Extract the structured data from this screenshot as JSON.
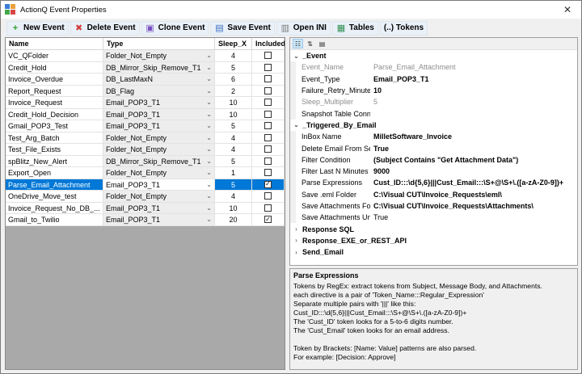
{
  "window": {
    "title": "ActionQ Event Properties",
    "close_glyph": "✕"
  },
  "toolbar": [
    {
      "label": "New Event",
      "icon": "plus-icon",
      "glyph": "+",
      "color": "#2e9e2e"
    },
    {
      "label": "Delete Event",
      "icon": "delete-document-icon",
      "glyph": "✖",
      "color": "#d23c3c"
    },
    {
      "label": "Clone Event",
      "icon": "clone-icon",
      "glyph": "▣",
      "color": "#7a4fbf"
    },
    {
      "label": "Save Event",
      "icon": "save-icon",
      "glyph": "▤",
      "color": "#3a6fc4"
    },
    {
      "label": "Open INI",
      "icon": "ini-file-icon",
      "glyph": "▥",
      "color": "#7a7a7a"
    },
    {
      "label": "Tables",
      "icon": "table-icon",
      "glyph": "▦",
      "color": "#2f8f4e"
    },
    {
      "label": "(..) Tokens",
      "icon": "",
      "glyph": "",
      "color": "#000000"
    }
  ],
  "grid": {
    "columns": [
      "Name",
      "Type",
      "Sleep_X",
      "Included"
    ],
    "rows": [
      {
        "name": "VC_QFolder",
        "type": "Folder_Not_Empty",
        "sleep": "4",
        "included": false
      },
      {
        "name": "Credit_Hold",
        "type": "DB_Mirror_Skip_Remove_T1",
        "sleep": "5",
        "included": false
      },
      {
        "name": "Invoice_Overdue",
        "type": "DB_LastMaxN",
        "sleep": "6",
        "included": false
      },
      {
        "name": "Report_Request",
        "type": "DB_Flag",
        "sleep": "2",
        "included": false
      },
      {
        "name": "Invoice_Request",
        "type": "Email_POP3_T1",
        "sleep": "10",
        "included": false
      },
      {
        "name": "Credit_Hold_Decision",
        "type": "Email_POP3_T1",
        "sleep": "10",
        "included": false
      },
      {
        "name": "Gmail_POP3_Test",
        "type": "Email_POP3_T1",
        "sleep": "5",
        "included": false
      },
      {
        "name": "Test_Arg_Batch",
        "type": "Folder_Not_Empty",
        "sleep": "4",
        "included": false
      },
      {
        "name": "Test_File_Exists",
        "type": "Folder_Not_Empty",
        "sleep": "4",
        "included": false
      },
      {
        "name": "spBlitz_New_Alert",
        "type": "DB_Mirror_Skip_Remove_T1",
        "sleep": "5",
        "included": false
      },
      {
        "name": "Export_Open",
        "type": "Folder_Not_Empty",
        "sleep": "1",
        "included": false
      },
      {
        "name": "Parse_Email_Attachment",
        "type": "Email_POP3_T1",
        "sleep": "5",
        "included": true,
        "selected": true
      },
      {
        "name": "OneDrive_Move_test",
        "type": "Folder_Not_Empty",
        "sleep": "4",
        "included": false
      },
      {
        "name": "Invoice_Request_No_DB_...",
        "type": "Email_POP3_T1",
        "sleep": "10",
        "included": false
      },
      {
        "name": "Gmail_to_Twilio",
        "type": "Email_POP3_T1",
        "sleep": "20",
        "included": true
      }
    ]
  },
  "props": {
    "categories": [
      {
        "label": "_Event",
        "expanded": true,
        "rows": [
          {
            "name": "Event_Name",
            "value": "Parse_Email_Attachment",
            "disabled": true
          },
          {
            "name": "Event_Type",
            "value": "Email_POP3_T1"
          },
          {
            "name": "Failure_Retry_Minutes",
            "value": "10"
          },
          {
            "name": "Sleep_Multiplier",
            "value": "5",
            "disabled": true
          },
          {
            "name": "Snapshot Table Connection",
            "value": ""
          }
        ]
      },
      {
        "label": "_Triggered_By_Email",
        "expanded": true,
        "rows": [
          {
            "name": "InBox Name",
            "value": "MilletSoftware_Invoice"
          },
          {
            "name": "Delete Email From Server",
            "value": "True"
          },
          {
            "name": "Filter Condition",
            "value": "(Subject Contains \"Get Attachment Data\")"
          },
          {
            "name": "Filter Last N Minutes",
            "value": "9000"
          },
          {
            "name": "Parse Expressions",
            "value": "Cust_ID:::\\d{5,6}|||Cust_Email:::\\S+@\\S+\\.([a-zA-Z0-9])+"
          },
          {
            "name": "Save .eml Folder",
            "value": "C:\\Visual CUT\\Invoice_Requests\\eml\\"
          },
          {
            "name": "Save Attachments Folder",
            "value": "C:\\Visual CUT\\Invoice_Requests\\Attachments\\"
          },
          {
            "name": "Save Attachments Unzipped",
            "value": "True",
            "plain": true
          }
        ]
      },
      {
        "label": "Response SQL",
        "expanded": false,
        "rows": []
      },
      {
        "label": "Response_EXE_or_REST_API",
        "expanded": false,
        "rows": []
      },
      {
        "label": "Send_Email",
        "expanded": false,
        "rows": []
      }
    ]
  },
  "description": {
    "title": "Parse Expressions",
    "lines": [
      "Tokens by RegEx: extract tokens from Subject, Message Body, and Attachments.",
      "each directive is a pair of 'Token_Name:::Regular_Expression'",
      "Separate multiple pairs with '|||' like this:",
      "Cust_ID:::\\d{5,6}|||Cust_Email:::\\S+@\\S+\\.([a-zA-Z0-9])+",
      "  The 'Cust_ID' token looks for a 5-to-6 digits number.",
      "  The 'Cust_Email' token looks for an email address.",
      "",
      "Token by Brackets: [Name: Value] patterns are also parsed.",
      "For example: [Decision: Approve]"
    ]
  }
}
